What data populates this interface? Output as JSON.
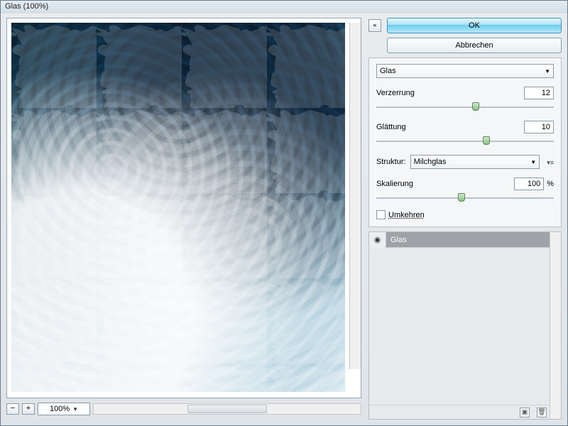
{
  "window": {
    "title": "Glas (100%)"
  },
  "buttons": {
    "ok": "OK",
    "cancel": "Abbrechen"
  },
  "filter_select": "Glas",
  "params": {
    "distortion": {
      "label": "Verzerrung",
      "value": "12",
      "pos": 56
    },
    "smoothing": {
      "label": "Glättung",
      "value": "10",
      "pos": 62
    },
    "texture": {
      "label": "Struktur:",
      "value": "Milchglas"
    },
    "scaling": {
      "label": "Skalierung",
      "value": "100",
      "unit": "%",
      "pos": 48
    },
    "invert": {
      "label": "Umkehren"
    }
  },
  "zoom": {
    "value": "100%"
  },
  "layer": {
    "name": "Glas"
  }
}
